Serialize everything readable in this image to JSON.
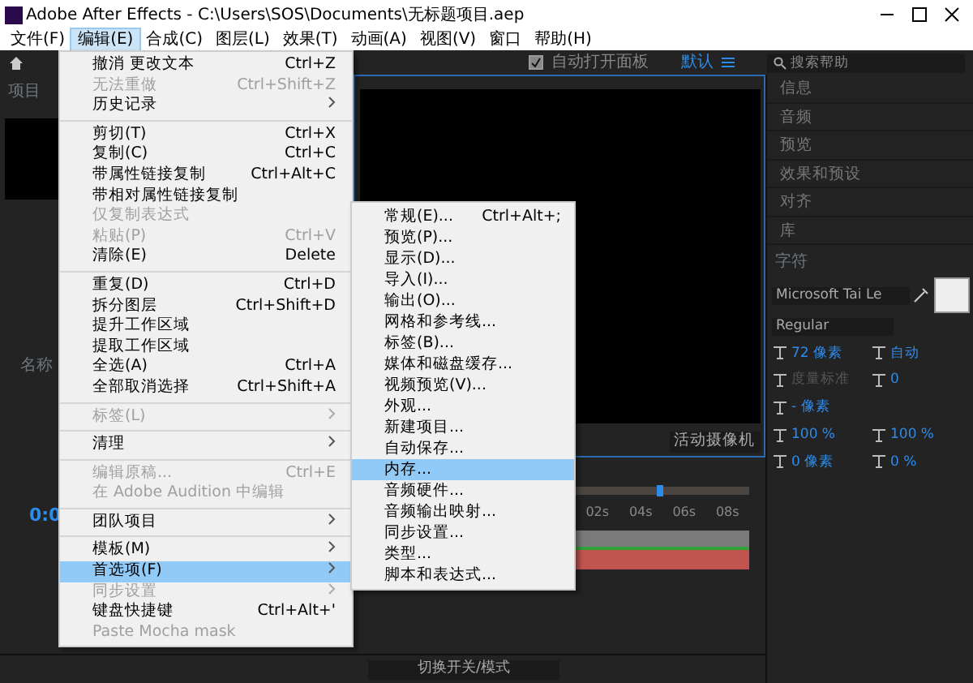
{
  "window": {
    "title": "Adobe After Effects - C:\\Users\\SOS\\Documents\\无标题项目.aep"
  },
  "menu_bar": [
    {
      "label": "文件(F)",
      "selected": false
    },
    {
      "label": "编辑(E)",
      "selected": true
    },
    {
      "label": "合成(C)",
      "selected": false
    },
    {
      "label": "图层(L)",
      "selected": false
    },
    {
      "label": "效果(T)",
      "selected": false
    },
    {
      "label": "动画(A)",
      "selected": false
    },
    {
      "label": "视图(V)",
      "selected": false
    },
    {
      "label": "窗口",
      "selected": false
    },
    {
      "label": "帮助(H)",
      "selected": false
    }
  ],
  "toolbar": {
    "auto_open_panels": {
      "label": "自动打开面板",
      "checked": true
    },
    "workspace": "默认",
    "search": {
      "placeholder": "搜索帮助"
    }
  },
  "project_panel": {
    "title": "项目",
    "column": "名称"
  },
  "viewer": {
    "camera": "活动摄像机"
  },
  "timeline": {
    "time": "0:0",
    "ruler": [
      "02s",
      "04s",
      "06s",
      "08s"
    ],
    "toggle": "切换开关/模式"
  },
  "right_panels": [
    "信息",
    "音频",
    "预览",
    "效果和预设",
    "对齐",
    "库"
  ],
  "character": {
    "title": "字符",
    "font": "Microsoft Tai Le",
    "style": "Regular",
    "fields": [
      {
        "value": "72 像素",
        "disabled": false
      },
      {
        "value": "自动",
        "disabled": false
      },
      {
        "value": "度量标准",
        "disabled": true
      },
      {
        "value": "0",
        "disabled": false
      },
      {
        "value": "- 像素",
        "disabled": false
      },
      {
        "value": "100 %",
        "disabled": false
      },
      {
        "value": "100 %",
        "disabled": false
      },
      {
        "value": "0 像素",
        "disabled": false
      },
      {
        "value": "0 %",
        "disabled": false
      }
    ]
  },
  "edit_menu": {
    "items": [
      {
        "kind": "item",
        "label": "撤消 更改文本",
        "shortcut": "Ctrl+Z",
        "disabled": false,
        "selected": false
      },
      {
        "kind": "item",
        "label": "无法重做",
        "shortcut": "Ctrl+Shift+Z",
        "disabled": true,
        "selected": false
      },
      {
        "kind": "item",
        "label": "历史记录",
        "disabled": false,
        "submenu": true,
        "selected": false
      },
      {
        "kind": "separator"
      },
      {
        "kind": "item",
        "label": "剪切(T)",
        "shortcut": "Ctrl+X",
        "disabled": false,
        "selected": false
      },
      {
        "kind": "item",
        "label": "复制(C)",
        "shortcut": "Ctrl+C",
        "disabled": false,
        "selected": false
      },
      {
        "kind": "item",
        "label": "带属性链接复制",
        "shortcut": "Ctrl+Alt+C",
        "disabled": false,
        "selected": false
      },
      {
        "kind": "item",
        "label": "带相对属性链接复制",
        "disabled": false,
        "selected": false
      },
      {
        "kind": "item",
        "label": "仅复制表达式",
        "disabled": true,
        "selected": false
      },
      {
        "kind": "item",
        "label": "粘贴(P)",
        "shortcut": "Ctrl+V",
        "disabled": true,
        "selected": false
      },
      {
        "kind": "item",
        "label": "清除(E)",
        "shortcut": "Delete",
        "disabled": false,
        "selected": false
      },
      {
        "kind": "separator"
      },
      {
        "kind": "item",
        "label": "重复(D)",
        "shortcut": "Ctrl+D",
        "disabled": false,
        "selected": false
      },
      {
        "kind": "item",
        "label": "拆分图层",
        "shortcut": "Ctrl+Shift+D",
        "disabled": false,
        "selected": false
      },
      {
        "kind": "item",
        "label": "提升工作区域",
        "disabled": false,
        "selected": false
      },
      {
        "kind": "item",
        "label": "提取工作区域",
        "disabled": false,
        "selected": false
      },
      {
        "kind": "item",
        "label": "全选(A)",
        "shortcut": "Ctrl+A",
        "disabled": false,
        "selected": false
      },
      {
        "kind": "item",
        "label": "全部取消选择",
        "shortcut": "Ctrl+Shift+A",
        "disabled": false,
        "selected": false
      },
      {
        "kind": "separator"
      },
      {
        "kind": "item",
        "label": "标签(L)",
        "disabled": true,
        "submenu": true,
        "selected": false
      },
      {
        "kind": "separator"
      },
      {
        "kind": "item",
        "label": "清理",
        "disabled": false,
        "submenu": true,
        "selected": false
      },
      {
        "kind": "separator"
      },
      {
        "kind": "item",
        "label": "编辑原稿...",
        "shortcut": "Ctrl+E",
        "disabled": true,
        "selected": false
      },
      {
        "kind": "item",
        "label": "在 Adobe Audition 中编辑",
        "disabled": true,
        "selected": false
      },
      {
        "kind": "separator"
      },
      {
        "kind": "item",
        "label": "团队项目",
        "disabled": false,
        "submenu": true,
        "selected": false
      },
      {
        "kind": "separator"
      },
      {
        "kind": "item",
        "label": "模板(M)",
        "disabled": false,
        "submenu": true,
        "selected": false
      },
      {
        "kind": "item",
        "label": "首选项(F)",
        "disabled": false,
        "submenu": true,
        "selected": true
      },
      {
        "kind": "item",
        "label": "同步设置",
        "disabled": true,
        "submenu": true,
        "selected": false
      },
      {
        "kind": "item",
        "label": "键盘快捷键",
        "shortcut": "Ctrl+Alt+'",
        "disabled": false,
        "selected": false
      },
      {
        "kind": "item",
        "label": "Paste Mocha mask",
        "disabled": true,
        "selected": false
      }
    ]
  },
  "preferences_submenu": {
    "items": [
      {
        "label": "常规(E)...",
        "shortcut": "Ctrl+Alt+;",
        "selected": false
      },
      {
        "label": "预览(P)...",
        "selected": false
      },
      {
        "label": "显示(D)...",
        "selected": false
      },
      {
        "label": "导入(I)...",
        "selected": false
      },
      {
        "label": "输出(O)...",
        "selected": false
      },
      {
        "label": "网格和参考线...",
        "selected": false
      },
      {
        "label": "标签(B)...",
        "selected": false
      },
      {
        "label": "媒体和磁盘缓存...",
        "selected": false
      },
      {
        "label": "视频预览(V)...",
        "selected": false
      },
      {
        "label": "外观...",
        "selected": false
      },
      {
        "label": "新建项目...",
        "selected": false
      },
      {
        "label": "自动保存...",
        "selected": false
      },
      {
        "label": "内存...",
        "selected": true
      },
      {
        "label": "音频硬件...",
        "selected": false
      },
      {
        "label": "音频输出映射...",
        "selected": false
      },
      {
        "label": "同步设置...",
        "selected": false
      },
      {
        "label": "类型...",
        "selected": false
      },
      {
        "label": "脚本和表达式...",
        "selected": false
      }
    ]
  }
}
